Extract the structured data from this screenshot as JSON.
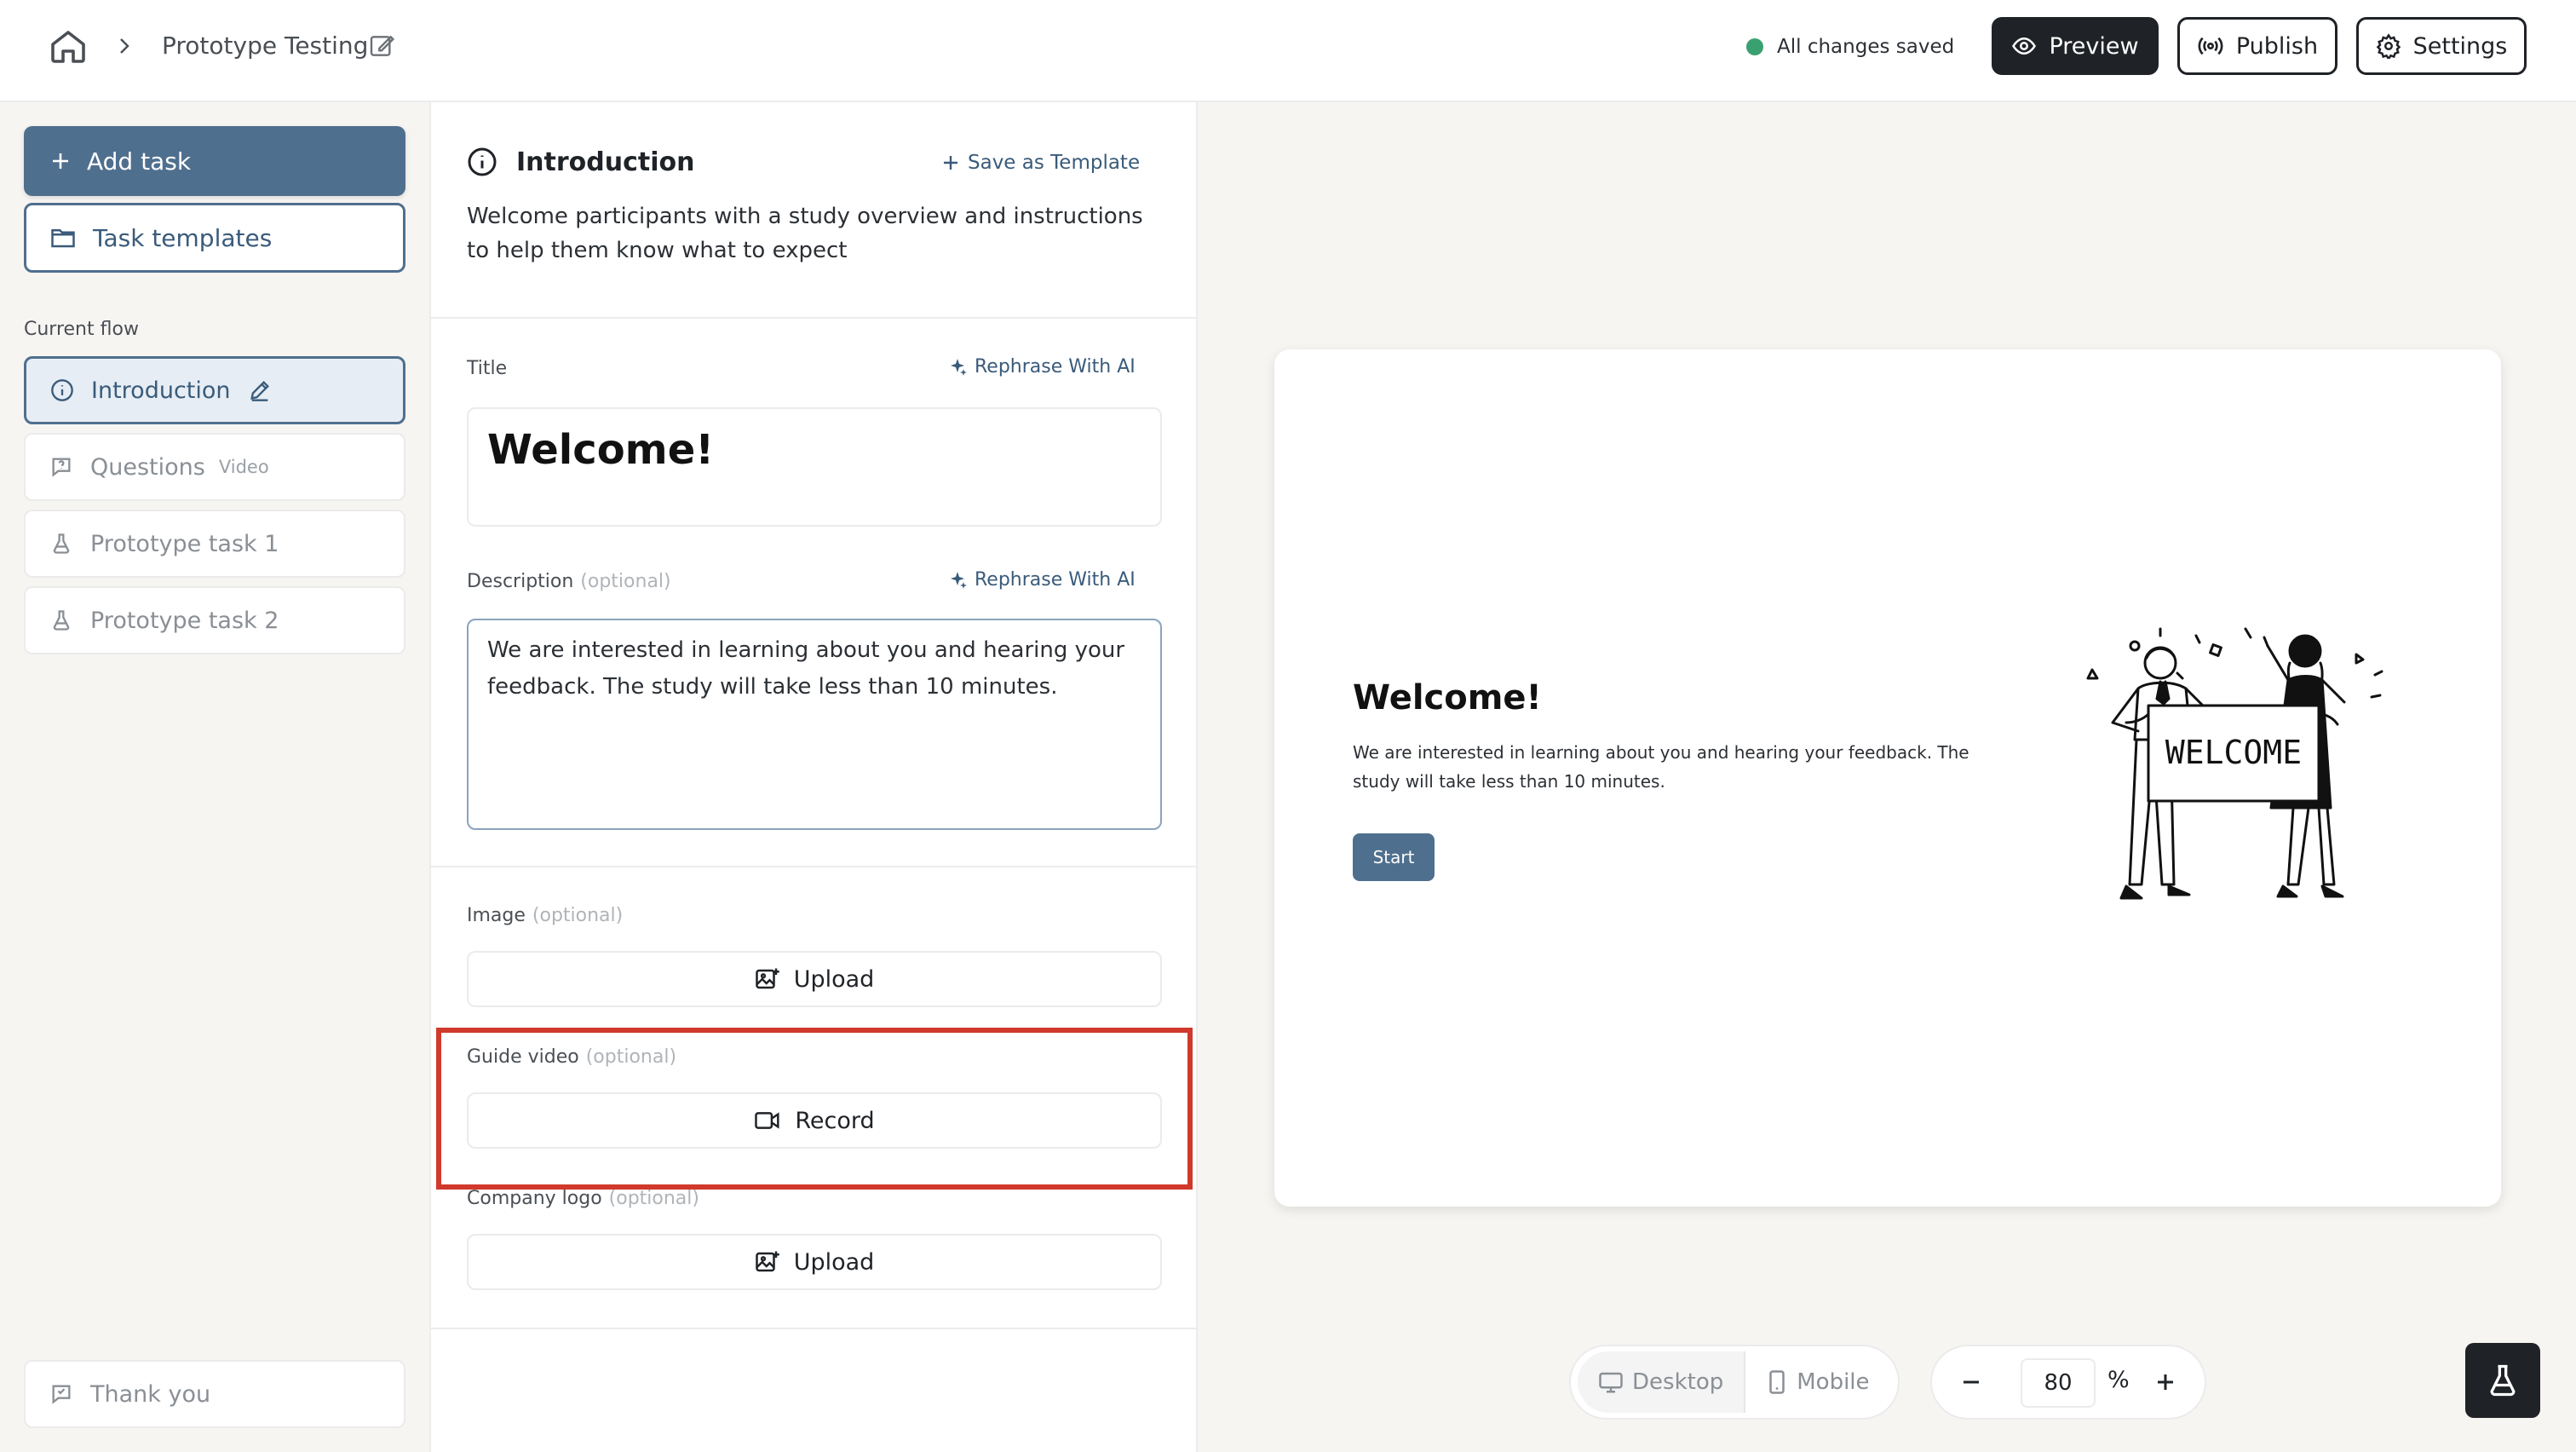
{
  "topbar": {
    "project_name": "Prototype Testing",
    "save_status": "All changes saved",
    "preview_label": "Preview",
    "publish_label": "Publish",
    "settings_label": "Settings"
  },
  "sidebar": {
    "add_task_label": "Add task",
    "task_templates_label": "Task templates",
    "current_flow_label": "Current flow",
    "flow_items": [
      {
        "label": "Introduction",
        "sub": ""
      },
      {
        "label": "Questions",
        "sub": "Video"
      },
      {
        "label": "Prototype task 1",
        "sub": ""
      },
      {
        "label": "Prototype task 2",
        "sub": ""
      }
    ],
    "thank_you_label": "Thank you"
  },
  "editor": {
    "section_title": "Introduction",
    "save_template_label": "Save as Template",
    "section_desc": "Welcome participants with a study overview and instructions to help them know what to expect",
    "title_label": "Title",
    "rephrase_label": "Rephrase With AI",
    "title_value": "Welcome!",
    "description_label": "Description",
    "optional_label": "(optional)",
    "description_value": "We are interested in learning about you and hearing your feedback. The study will take less than 10 minutes.",
    "image_label": "Image",
    "upload_label": "Upload",
    "guide_video_label": "Guide video",
    "record_label": "Record",
    "company_logo_label": "Company logo"
  },
  "preview": {
    "title": "Welcome!",
    "description": "We are interested in learning about you and hearing your feedback. The study will take less than 10 minutes.",
    "start_label": "Start",
    "banner_text": "WELCOME",
    "desktop_label": "Desktop",
    "mobile_label": "Mobile",
    "zoom_value": "80",
    "zoom_unit": "%"
  },
  "colors": {
    "accent": "#4f6f8e",
    "dark": "#1f2226",
    "saved_dot": "#3aa070",
    "highlight": "#d0392b",
    "panel_bg": "#f7f5f2"
  }
}
